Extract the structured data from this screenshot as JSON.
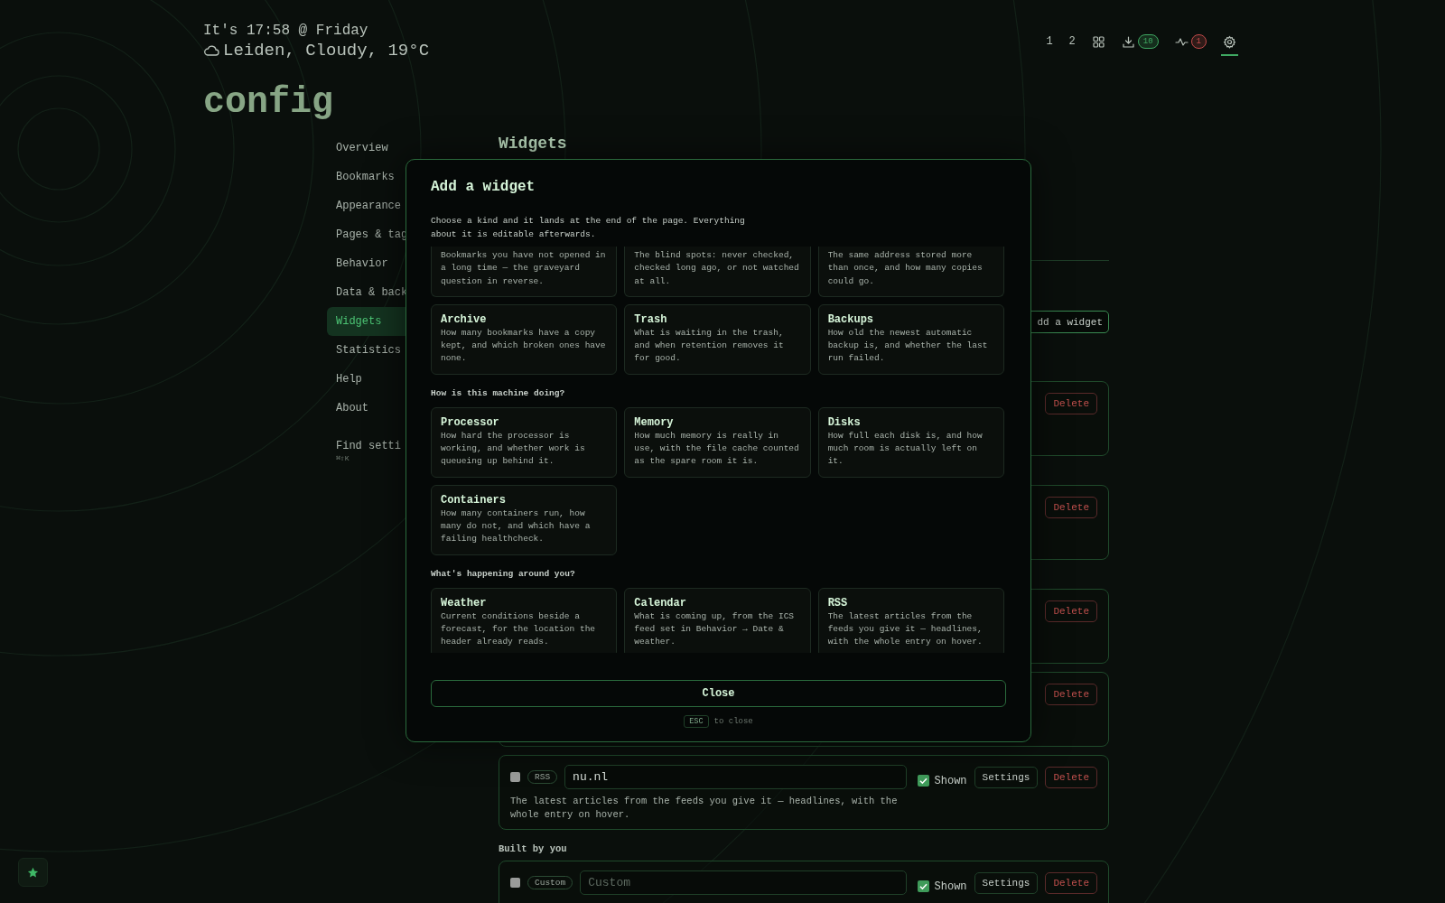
{
  "header": {
    "clock": "It's 17:58 @ Friday",
    "weather": "Leiden, Cloudy, 19°C",
    "title": "config"
  },
  "top_nav": [
    {
      "kind": "page",
      "label": "1",
      "selected": false
    },
    {
      "kind": "page",
      "label": "2",
      "selected": false
    },
    {
      "kind": "grid",
      "selected": false
    },
    {
      "kind": "downloads",
      "count": "10",
      "color": "#3fa862",
      "selected": false
    },
    {
      "kind": "activity",
      "count": "1",
      "color": "#c24a4a",
      "selected": false
    },
    {
      "kind": "settings",
      "selected": true
    }
  ],
  "sidebar": {
    "items": [
      {
        "label": "Overview",
        "selected": false
      },
      {
        "label": "Bookmarks",
        "selected": false
      },
      {
        "label": "Appearance",
        "selected": false
      },
      {
        "label": "Pages & tag",
        "selected": false
      },
      {
        "label": "Behavior",
        "selected": false
      },
      {
        "label": "Data & back",
        "selected": false
      },
      {
        "label": "Widgets",
        "selected": true
      },
      {
        "label": "Statistics",
        "selected": false
      },
      {
        "label": "Help",
        "selected": false
      },
      {
        "label": "About",
        "selected": false
      }
    ],
    "search": {
      "label": "Find setti",
      "shortcut": "⌘⇧K"
    }
  },
  "content": {
    "title": "Widgets",
    "add_button": "dd a widget",
    "groups": [
      {
        "cards": [
          {
            "kind": "obscured",
            "delete": "Delete"
          }
        ]
      },
      {
        "cards": [
          {
            "kind": "obscured",
            "delete": "Delete"
          }
        ]
      },
      {
        "cards": [
          {
            "kind": "obscured",
            "delete": "Delete"
          },
          {
            "kind": "obscured",
            "delete": "Delete"
          },
          {
            "kind": "widget",
            "selected": false,
            "type": "RSS",
            "value": "nu.nl",
            "shown": true,
            "shown_label": "Shown",
            "settings": "Settings",
            "delete": "Delete",
            "description": "The latest articles from the feeds you give it — headlines, with the whole entry on hover."
          }
        ]
      },
      {
        "heading": "Built by you",
        "cards": [
          {
            "kind": "widget",
            "selected": false,
            "type": "Custom",
            "placeholder": "Custom",
            "shown": true,
            "shown_label": "Shown",
            "settings": "Settings",
            "delete": "Delete"
          }
        ]
      }
    ]
  },
  "dialog": {
    "title": "Add a widget",
    "description": "Choose a kind and it lands at the end of the page. Everything about it is editable afterwards.",
    "groups": [
      {
        "cards": [
          {
            "description": "Bookmarks you have not opened in a long time — the graveyard question in reverse."
          },
          {
            "description": "The blind spots: never checked, checked long ago, or not watched at all."
          },
          {
            "description": "The same address stored more than once, and how many copies could go."
          },
          {
            "title": "Archive",
            "description": "How many bookmarks have a copy kept, and which broken ones have none."
          },
          {
            "title": "Trash",
            "description": "What is waiting in the trash, and when retention removes it for good."
          },
          {
            "title": "Backups",
            "description": "How old the newest automatic backup is, and whether the last run failed."
          }
        ]
      },
      {
        "heading": "How is this machine doing?",
        "cards": [
          {
            "title": "Processor",
            "description": "How hard the processor is working, and whether work is queueing up behind it."
          },
          {
            "title": "Memory",
            "description": "How much memory is really in use, with the file cache counted as the spare room it is."
          },
          {
            "title": "Disks",
            "description": "How full each disk is, and how much room is actually left on it."
          },
          {
            "title": "Containers",
            "description": "How many containers run, how many do not, and which have a failing healthcheck."
          }
        ]
      },
      {
        "heading": "What's happening around you?",
        "cards": [
          {
            "title": "Weather",
            "description": "Current conditions beside a forecast, for the location the header already reads."
          },
          {
            "title": "Calendar",
            "description": "What is coming up, from the ICS feed set in Behavior → Date & weather."
          },
          {
            "title": "RSS",
            "description": "The latest articles from the feeds you give it — headlines, with the whole entry on hover."
          }
        ]
      }
    ],
    "close": "Close",
    "hint_key": "ESC",
    "hint": "to close"
  }
}
